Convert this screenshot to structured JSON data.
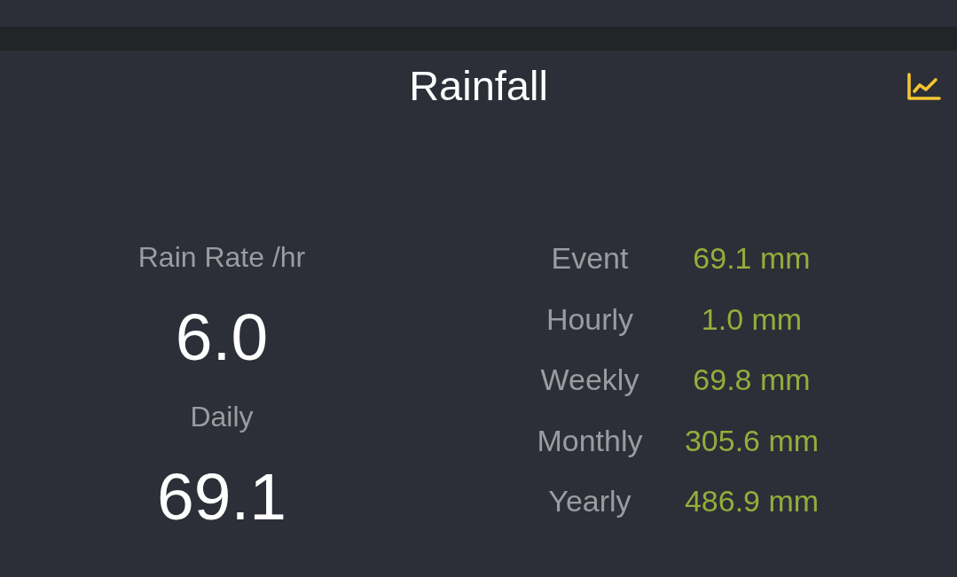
{
  "header": {
    "title": "Rainfall"
  },
  "rate": {
    "label": "Rain Rate /hr",
    "value": "6.0"
  },
  "daily": {
    "label": "Daily",
    "value": "69.1"
  },
  "totals": [
    {
      "label": "Event",
      "value": "69.1 mm"
    },
    {
      "label": "Hourly",
      "value": "1.0 mm"
    },
    {
      "label": "Weekly",
      "value": "69.8 mm"
    },
    {
      "label": "Monthly",
      "value": "305.6 mm"
    },
    {
      "label": "Yearly",
      "value": "486.9 mm"
    }
  ]
}
